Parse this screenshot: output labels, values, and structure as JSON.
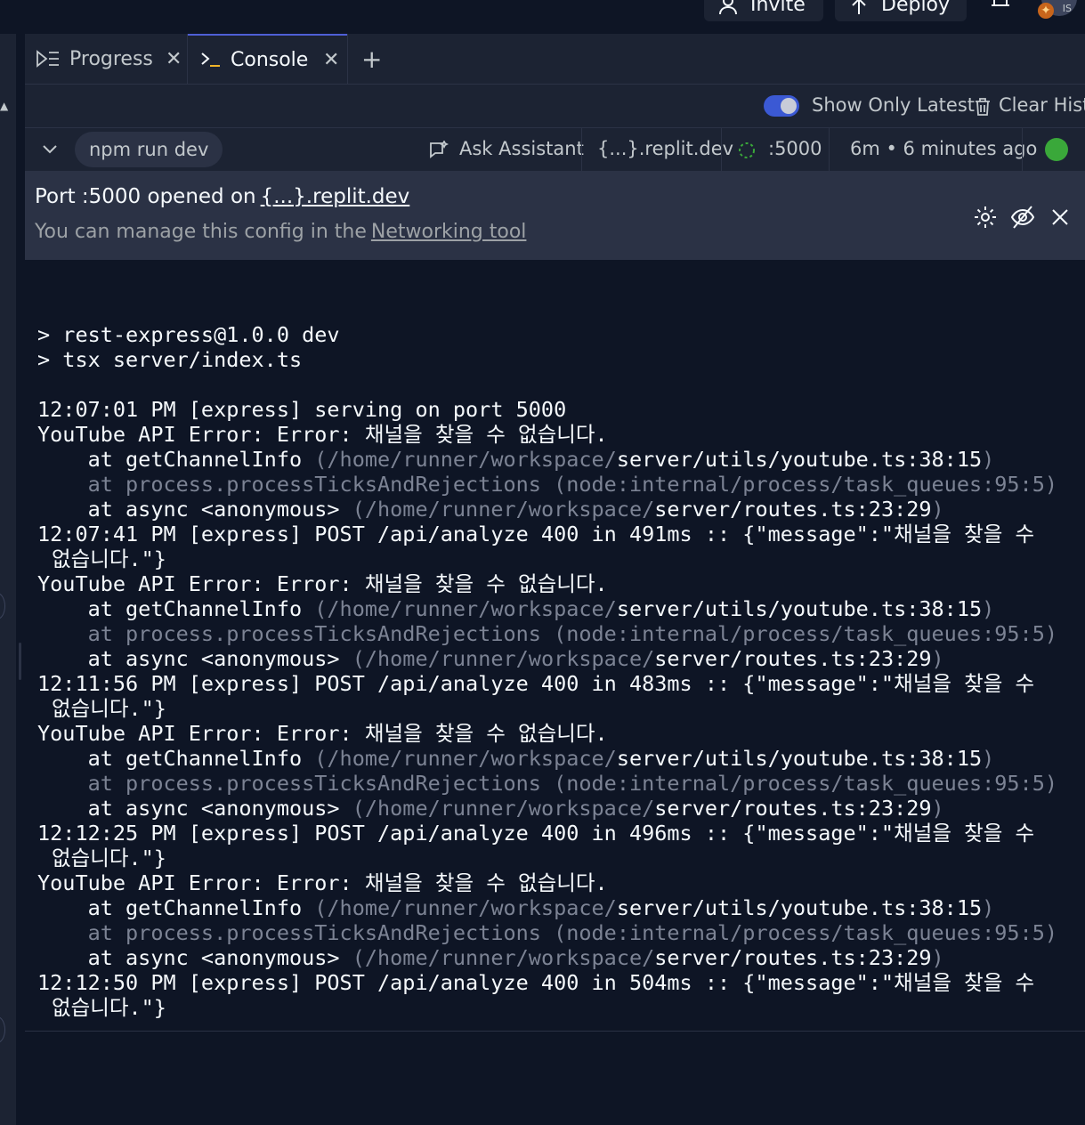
{
  "topbar": {
    "invite_label": "Invite",
    "deploy_label": "Deploy",
    "avatar_initials": "IS"
  },
  "tabs": [
    {
      "label": "Progress",
      "icon": "progress-icon",
      "active": false
    },
    {
      "label": "Console",
      "icon": "terminal-icon",
      "active": true
    }
  ],
  "toolbar": {
    "show_latest_label": "Show Only Latest",
    "show_latest_on": true,
    "clear_history_label": "Clear History"
  },
  "run": {
    "command": "npm run dev",
    "ask_assistant": "Ask Assistant",
    "domain": "{...}.replit.dev",
    "port": ":5000",
    "uptime": "6m • 6 minutes ago",
    "status_color": "#3aa83a"
  },
  "banner": {
    "line1_prefix": "Port :5000 opened on",
    "line1_link": "{...}.replit.dev",
    "line2_prefix": "You can manage this config in the",
    "line2_link": "Networking tool"
  },
  "console": {
    "lines": [
      {
        "text": "",
        "style": "normal"
      },
      {
        "text": "> rest-express@1.0.0 dev",
        "style": "normal"
      },
      {
        "text": "> tsx server/index.ts",
        "style": "normal"
      },
      {
        "text": "",
        "style": "normal"
      },
      {
        "text": "12:07:01 PM [express] serving on port 5000",
        "style": "normal"
      },
      {
        "text": "YouTube API Error: Error: 채널을 찾을 수 없습니다.",
        "style": "normal"
      },
      {
        "text": "    at getChannelInfo ",
        "style": "normal",
        "dim_suffix": "(/home/runner/workspace/",
        "bright_suffix": "server/utils/youtube.ts:38:15",
        "tail": ")"
      },
      {
        "text": "    at process.processTicksAndRejections (node:internal/process/task_queues:95:5)",
        "style": "dim"
      },
      {
        "text": "    at async <anonymous> ",
        "style": "normal",
        "dim_suffix": "(/home/runner/workspace/",
        "bright_suffix": "server/routes.ts:23:29",
        "tail": ")"
      },
      {
        "text": "12:07:41 PM [express] POST /api/analyze 400 in 491ms :: {\"message\":\"채널을 찾을 수",
        "style": "normal"
      },
      {
        "text": "없습니다.\"}",
        "style": "wrap"
      },
      {
        "text": "YouTube API Error: Error: 채널을 찾을 수 없습니다.",
        "style": "normal"
      },
      {
        "text": "    at getChannelInfo ",
        "style": "normal",
        "dim_suffix": "(/home/runner/workspace/",
        "bright_suffix": "server/utils/youtube.ts:38:15",
        "tail": ")"
      },
      {
        "text": "    at process.processTicksAndRejections (node:internal/process/task_queues:95:5)",
        "style": "dim"
      },
      {
        "text": "    at async <anonymous> ",
        "style": "normal",
        "dim_suffix": "(/home/runner/workspace/",
        "bright_suffix": "server/routes.ts:23:29",
        "tail": ")"
      },
      {
        "text": "12:11:56 PM [express] POST /api/analyze 400 in 483ms :: {\"message\":\"채널을 찾을 수",
        "style": "normal"
      },
      {
        "text": "없습니다.\"}",
        "style": "wrap"
      },
      {
        "text": "YouTube API Error: Error: 채널을 찾을 수 없습니다.",
        "style": "normal"
      },
      {
        "text": "    at getChannelInfo ",
        "style": "normal",
        "dim_suffix": "(/home/runner/workspace/",
        "bright_suffix": "server/utils/youtube.ts:38:15",
        "tail": ")"
      },
      {
        "text": "    at process.processTicksAndRejections (node:internal/process/task_queues:95:5)",
        "style": "dim"
      },
      {
        "text": "    at async <anonymous> ",
        "style": "normal",
        "dim_suffix": "(/home/runner/workspace/",
        "bright_suffix": "server/routes.ts:23:29",
        "tail": ")"
      },
      {
        "text": "12:12:25 PM [express] POST /api/analyze 400 in 496ms :: {\"message\":\"채널을 찾을 수",
        "style": "normal"
      },
      {
        "text": "없습니다.\"}",
        "style": "wrap"
      },
      {
        "text": "YouTube API Error: Error: 채널을 찾을 수 없습니다.",
        "style": "normal"
      },
      {
        "text": "    at getChannelInfo ",
        "style": "normal",
        "dim_suffix": "(/home/runner/workspace/",
        "bright_suffix": "server/utils/youtube.ts:38:15",
        "tail": ")"
      },
      {
        "text": "    at process.processTicksAndRejections (node:internal/process/task_queues:95:5)",
        "style": "dim"
      },
      {
        "text": "    at async <anonymous> ",
        "style": "normal",
        "dim_suffix": "(/home/runner/workspace/",
        "bright_suffix": "server/routes.ts:23:29",
        "tail": ")"
      },
      {
        "text": "12:12:50 PM [express] POST /api/analyze 400 in 504ms :: {\"message\":\"채널을 찾을 수",
        "style": "normal"
      },
      {
        "text": "없습니다.\"}",
        "style": "wrap"
      }
    ]
  }
}
